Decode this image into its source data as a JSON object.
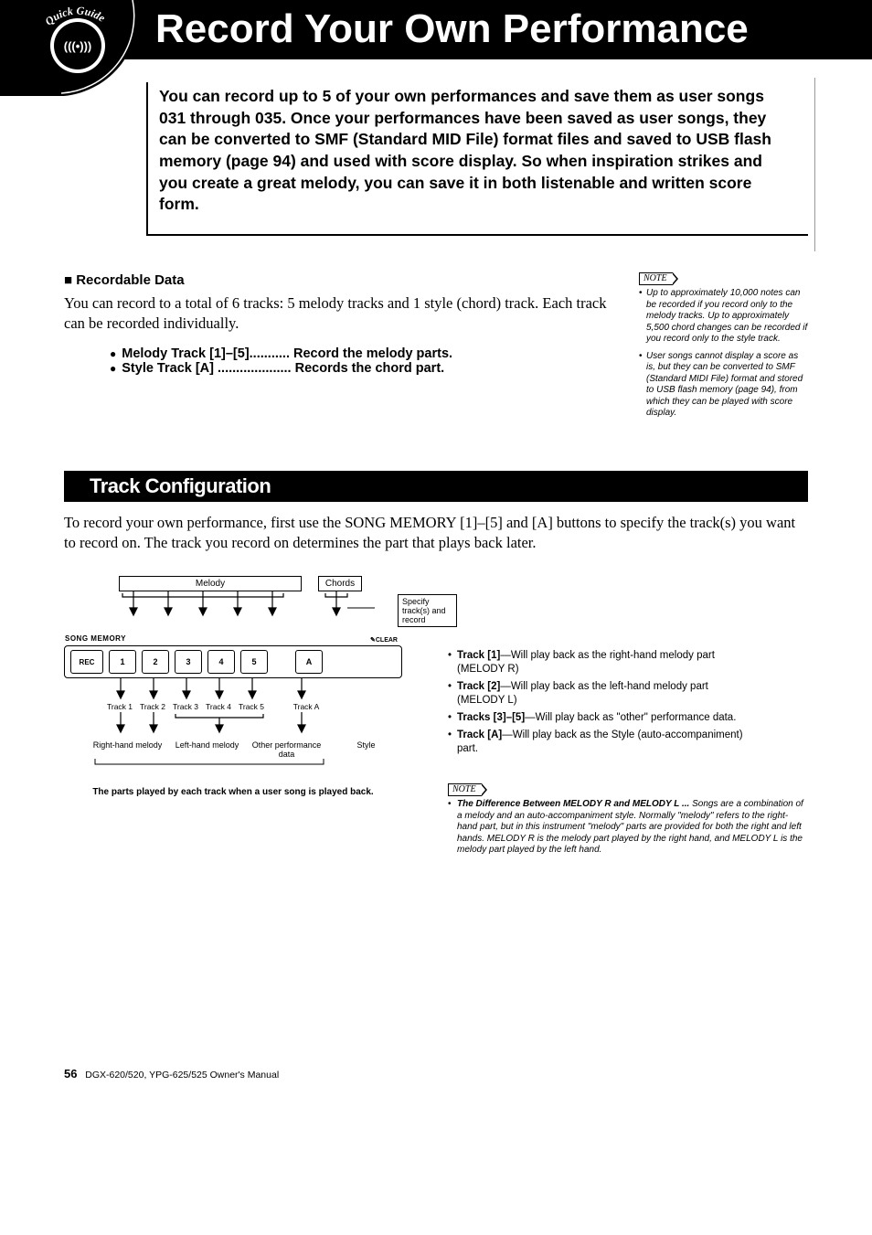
{
  "header": {
    "title": "Record Your Own Performance",
    "badge_text": "Quick Guide"
  },
  "intro": "You can record up to 5 of your own performances and save them as user songs 031 through 035. Once your performances have been saved as user songs, they can be converted to SMF (Standard MID File) format files and saved to USB flash memory (page 94) and used with score display. So when inspiration strikes and you create a great melody, you can save it in both listenable and written score form.",
  "recordable": {
    "heading": "■ Recordable Data",
    "body": "You can record to a total of 6 tracks: 5 melody tracks and 1 style (chord) track. Each track can be recorded individually.",
    "lines": [
      "Melody Track [1]–[5]........... Record the melody parts.",
      "Style Track [A] .................... Records the chord part."
    ]
  },
  "note1": {
    "label": "NOTE",
    "items": [
      "Up to approximately 10,000 notes can be recorded if you record only to the melody tracks. Up to approximately 5,500 chord changes can be recorded if you record only to the style track.",
      "User songs cannot display a score as is, but they can be converted to SMF (Standard MIDI File) format and stored to USB flash memory (page 94), from which they can be played with score display."
    ]
  },
  "track_config": {
    "heading": "Track Configuration",
    "body": "To record your own performance, first use the SONG MEMORY [1]–[5] and [A] buttons to specify the track(s) you want to record on. The track you record on determines the part that plays back later."
  },
  "diagram": {
    "melody_label": "Melody",
    "chords_label": "Chords",
    "specify": "Specify track(s) and record",
    "song_memory": "SONG MEMORY",
    "clear": "CLEAR",
    "buttons": [
      "REC",
      "1",
      "2",
      "3",
      "4",
      "5",
      "A"
    ],
    "track_labels": [
      "Track 1",
      "Track 2",
      "Track 3",
      "Track 4",
      "Track 5",
      "Track A"
    ],
    "bottom_labels": [
      "Right-hand melody",
      "Left-hand melody",
      "Other performance data",
      "Style"
    ],
    "caption": "The parts played by each track when a user song is played back."
  },
  "track_desc": [
    {
      "b": "Track [1]",
      "t": "—Will play back as the right-hand melody part (MELODY R)"
    },
    {
      "b": "Track [2]",
      "t": "—Will play back as the left-hand melody part (MELODY L)"
    },
    {
      "b": "Tracks [3]–[5]",
      "t": "—Will play back as \"other\" performance data."
    },
    {
      "b": "Track [A]",
      "t": "—Will play back as the Style (auto-accompaniment) part."
    }
  ],
  "note2": {
    "label": "NOTE",
    "title": "The Difference Between MELODY R and MELODY L ...",
    "body": "Songs are a combination of a melody and an auto-accompaniment style. Normally \"melody\" refers to the right-hand part, but in this instrument \"melody\" parts are provided for both the right and left hands. MELODY R is the melody part played by the right hand, and MELODY L is the melody part played by the left hand."
  },
  "footer": {
    "page": "56",
    "manual": "DGX-620/520, YPG-625/525  Owner's Manual"
  }
}
